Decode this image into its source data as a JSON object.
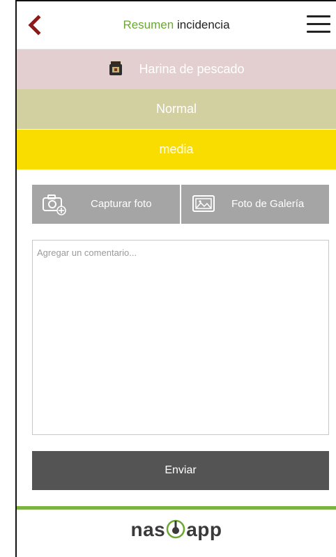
{
  "header": {
    "title_accent": "Resumen",
    "title_rest": "incidencia",
    "back_icon": "chevron-left-icon",
    "menu_icon": "hamburger-menu-icon",
    "accent_color": "#6aa830",
    "back_color": "#8b1a1a"
  },
  "incident": {
    "product": "Harina de pescado",
    "product_icon": "sack-icon",
    "status": "Normal",
    "level": "media",
    "colors": {
      "product_band": "#e3cfcf",
      "status_band": "#d2cfa0",
      "level_band": "#f9dc00"
    }
  },
  "actions": {
    "capture_photo": "Capturar foto",
    "capture_icon": "camera-add-icon",
    "gallery_photo": "Foto de Galería",
    "gallery_icon": "gallery-image-icon",
    "button_color": "#a5a5a5"
  },
  "comment": {
    "placeholder": "Agregar un comentario...",
    "value": ""
  },
  "submit": {
    "label": "Enviar",
    "color": "#545454"
  },
  "footer": {
    "brand_left": "nas",
    "brand_right": "app",
    "line_color": "#7cb342"
  }
}
